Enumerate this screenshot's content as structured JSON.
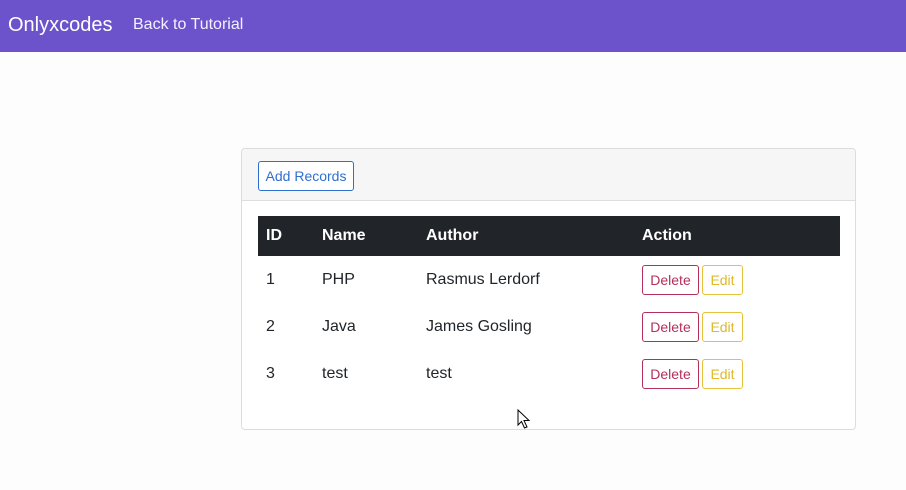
{
  "navbar": {
    "brand": "Onlyxcodes",
    "link": "Back to Tutorial",
    "color": "#6c53cc"
  },
  "card": {
    "add_button": "Add Records"
  },
  "table": {
    "headers": [
      "ID",
      "Name",
      "Author",
      "Action"
    ],
    "rows": [
      {
        "id": "1",
        "name": "PHP",
        "author": "Rasmus Lerdorf"
      },
      {
        "id": "2",
        "name": "Java",
        "author": "James Gosling"
      },
      {
        "id": "3",
        "name": "test",
        "author": "test"
      }
    ],
    "delete_label": "Delete",
    "edit_label": "Edit"
  }
}
